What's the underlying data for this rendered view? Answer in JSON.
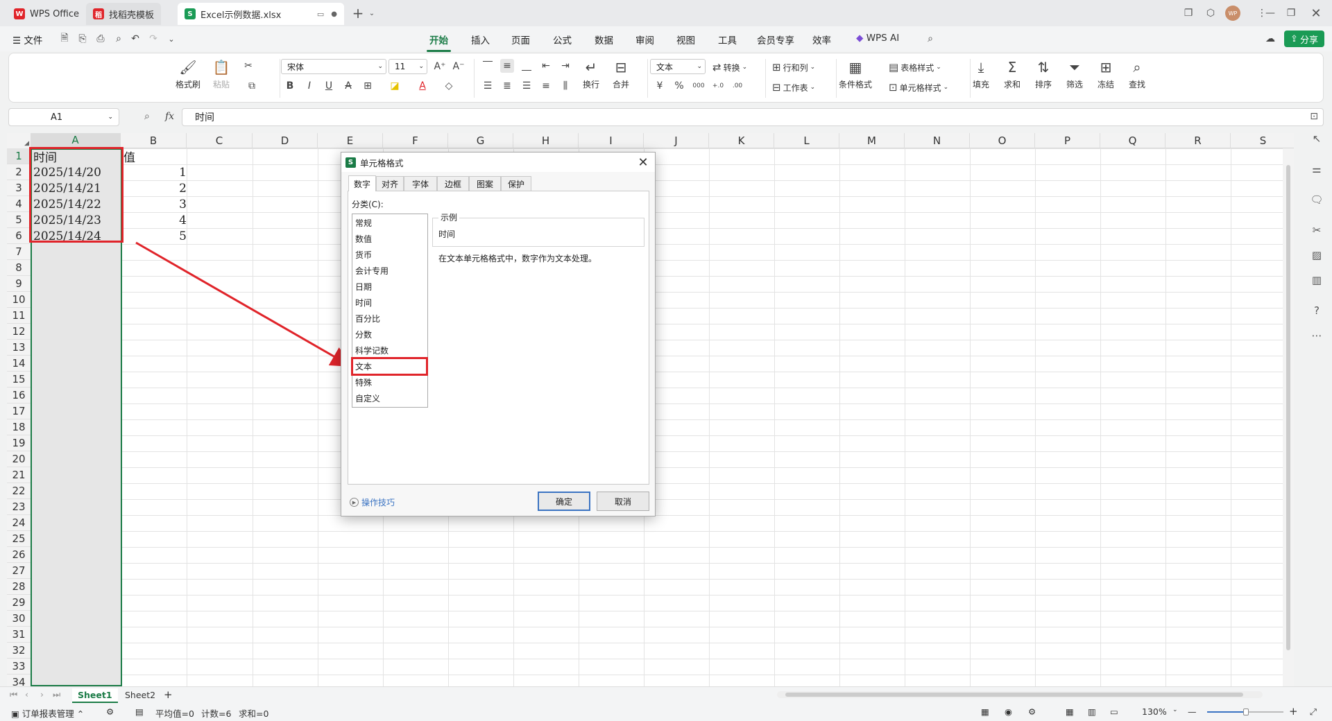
{
  "tabs": [
    {
      "label": "WPS Office",
      "icon": "wps-logo-icon"
    },
    {
      "label": "找稻壳模板",
      "icon": "docer-icon"
    },
    {
      "label": "Excel示例数据.xlsx",
      "icon": "sheet-icon"
    }
  ],
  "titlebar": {
    "avatar": "WP"
  },
  "menu": {
    "file": "文件",
    "items": [
      "开始",
      "插入",
      "页面",
      "公式",
      "数据",
      "审阅",
      "视图",
      "工具",
      "会员专享",
      "效率"
    ],
    "active": "开始",
    "wps_ai": "WPS AI",
    "share": "分享"
  },
  "ribbon": {
    "format_painter": "格式刷",
    "paste": "粘贴",
    "font_name": "宋体",
    "font_size": "11",
    "wrap": "换行",
    "merge": "合并",
    "number_format": "文本",
    "convert": "转换",
    "row_col": "行和列",
    "worksheet": "工作表",
    "cond_format": "条件格式",
    "table_style": "表格样式",
    "cell_style": "单元格样式",
    "fill": "填充",
    "sum": "求和",
    "sort": "排序",
    "filter": "筛选",
    "freeze": "冻结",
    "find": "查找",
    "bold": "B",
    "italic": "I",
    "underline": "U",
    "currency": "¥",
    "percent": "%",
    "thousands": "000",
    "dec_inc": "+.0",
    "dec_dec": ".00"
  },
  "formula_bar": {
    "cell_ref": "A1",
    "fx": "fx",
    "content": "时间"
  },
  "sheet": {
    "columns": [
      "A",
      "B",
      "C",
      "D",
      "E",
      "F",
      "G",
      "H",
      "I",
      "J",
      "K",
      "L",
      "M",
      "N",
      "O",
      "P",
      "Q",
      "R",
      "S"
    ],
    "row_count": 34,
    "cells": {
      "A": [
        "时间",
        "2025/14/20",
        "2025/14/21",
        "2025/14/22",
        "2025/14/23",
        "2025/14/24"
      ],
      "B": [
        "值",
        "1",
        "2",
        "3",
        "4",
        "5"
      ]
    }
  },
  "sheet_tabs": {
    "tabs": [
      "Sheet1",
      "Sheet2"
    ],
    "active": "Sheet1",
    "add": "+"
  },
  "status": {
    "report": "订单报表管理",
    "avg": "平均值=0",
    "count": "计数=6",
    "sum": "求和=0",
    "zoom": "130%"
  },
  "dialog": {
    "title": "单元格格式",
    "tabs": [
      "数字",
      "对齐",
      "字体",
      "边框",
      "图案",
      "保护"
    ],
    "active_tab": "数字",
    "category_label": "分类(C):",
    "categories": [
      "常规",
      "数值",
      "货币",
      "会计专用",
      "日期",
      "时间",
      "百分比",
      "分数",
      "科学记数",
      "文本",
      "特殊",
      "自定义"
    ],
    "selected_category": "文本",
    "sample_label": "示例",
    "sample_value": "时间",
    "description": "在文本单元格格式中，数字作为文本处理。",
    "tips": "操作技巧",
    "ok": "确定",
    "cancel": "取消"
  },
  "colors": {
    "accent": "#1a7b46",
    "highlight": "#e0242a",
    "dialog_button": "#3a73c2"
  }
}
